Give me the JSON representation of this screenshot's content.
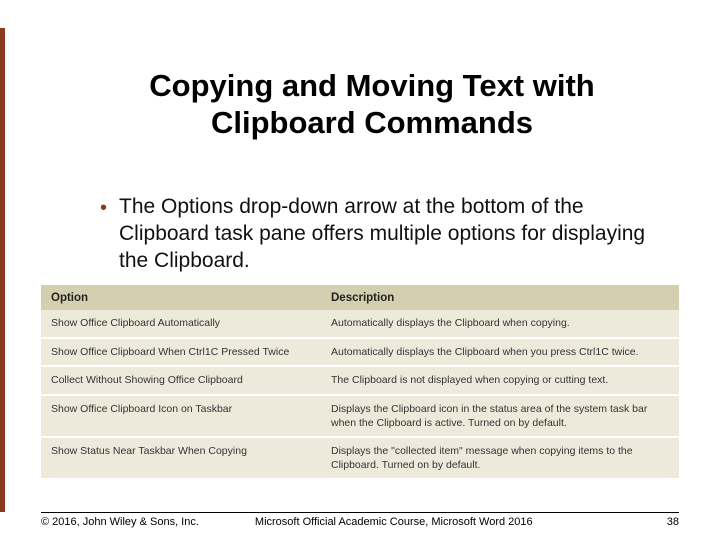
{
  "title": "Copying and Moving Text with Clipboard Commands",
  "bullet": "The Options drop-down arrow at the bottom of the Clipboard task pane offers multiple options for displaying the Clipboard.",
  "table": {
    "headers": {
      "option": "Option",
      "description": "Description"
    },
    "rows": [
      {
        "option": "Show Office Clipboard Automatically",
        "description": "Automatically displays the Clipboard when copying."
      },
      {
        "option": "Show Office Clipboard When Ctrl1C Pressed Twice",
        "description": "Automatically displays the Clipboard when you press Ctrl1C twice."
      },
      {
        "option": "Collect Without Showing Office Clipboard",
        "description": "The Clipboard is not displayed when copying or cutting text."
      },
      {
        "option": "Show Office Clipboard Icon on Taskbar",
        "description": "Displays the Clipboard icon in the status area of the system task bar when the Clipboard is active. Turned on by default."
      },
      {
        "option": "Show Status Near Taskbar When Copying",
        "description": "Displays the \"collected item\" message when copying items to the Clipboard. Turned on by default."
      }
    ]
  },
  "footer": {
    "copyright": "© 2016, John Wiley & Sons, Inc.",
    "course": "Microsoft Official Academic Course, Microsoft Word 2016",
    "page": "38"
  }
}
